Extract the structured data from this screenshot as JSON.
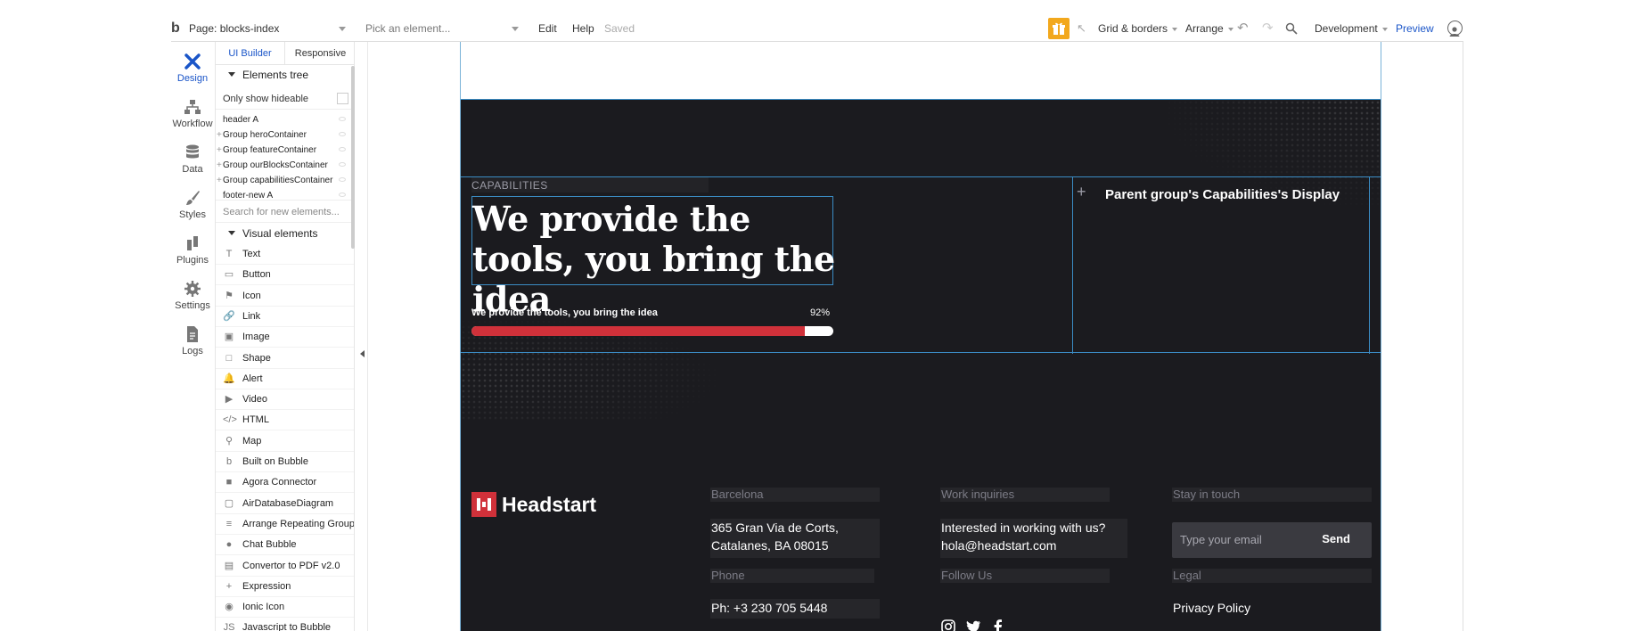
{
  "topbar": {
    "logo": "b",
    "page_select": "Page: blocks-index",
    "element_select": "Pick an element...",
    "edit": "Edit",
    "help": "Help",
    "saved": "Saved",
    "grid": "Grid & borders",
    "arrange": "Arrange",
    "environment": "Development",
    "preview": "Preview"
  },
  "sidebar": {
    "tabs": [
      {
        "label": "Design",
        "icon": "design-icon",
        "active": true
      },
      {
        "label": "Workflow",
        "icon": "workflow-icon"
      },
      {
        "label": "Data",
        "icon": "data-icon"
      },
      {
        "label": "Styles",
        "icon": "styles-icon"
      },
      {
        "label": "Plugins",
        "icon": "plugins-icon"
      },
      {
        "label": "Settings",
        "icon": "settings-icon"
      },
      {
        "label": "Logs",
        "icon": "logs-icon"
      }
    ]
  },
  "panel": {
    "tab_builder": "UI Builder",
    "tab_responsive": "Responsive",
    "tree_title": "Elements tree",
    "only_hideable": "Only show hideable",
    "tree": [
      "header A",
      "Group heroContainer",
      "Group featureContainer",
      "Group ourBlocksContainer",
      "Group capabilitiesContainer",
      "footer-new A"
    ],
    "search_placeholder": "Search for new elements...",
    "visual_title": "Visual elements",
    "elements": [
      {
        "label": "Text",
        "icon": "T"
      },
      {
        "label": "Button",
        "icon": "▭"
      },
      {
        "label": "Icon",
        "icon": "⚑"
      },
      {
        "label": "Link",
        "icon": "🔗"
      },
      {
        "label": "Image",
        "icon": "▣"
      },
      {
        "label": "Shape",
        "icon": "□"
      },
      {
        "label": "Alert",
        "icon": "🔔"
      },
      {
        "label": "Video",
        "icon": "▶"
      },
      {
        "label": "HTML",
        "icon": "</>"
      },
      {
        "label": "Map",
        "icon": "⚲"
      },
      {
        "label": "Built on Bubble",
        "icon": "b"
      },
      {
        "label": "Agora Connector",
        "icon": "■"
      },
      {
        "label": "AirDatabaseDiagram",
        "icon": "▢"
      },
      {
        "label": "Arrange Repeating Group",
        "icon": "≡"
      },
      {
        "label": "Chat Bubble",
        "icon": "●"
      },
      {
        "label": "Convertor to PDF v2.0",
        "icon": "▤"
      },
      {
        "label": "Expression",
        "icon": "+"
      },
      {
        "label": "Ionic Icon",
        "icon": "◉"
      },
      {
        "label": "Javascript to Bubble",
        "icon": "JS"
      }
    ]
  },
  "canvas": {
    "capabilities_label": "CAPABILITIES",
    "headline": "We provide the tools, you bring the idea",
    "progress_label": "We provide the tools, you bring the idea",
    "progress_percent_text": "92%",
    "progress_value": 0.92,
    "parent_group_text": "Parent group's Capabilities's Display",
    "footer": {
      "brand": "Headstart",
      "col1_title": "Barcelona",
      "col1_text": "365 Gran Via de Corts, Catalanes, BA 08015",
      "col2_title": "Work inquiries",
      "col2_text_1": "Interested in working with us?",
      "col2_text_2": "hola@headstart.com",
      "col3_title": "Stay in touch",
      "email_placeholder": "Type your email",
      "send": "Send",
      "phone_title": "Phone",
      "phone_text": "Ph: +3 230 705 5448",
      "follow_title": "Follow Us",
      "legal_title": "Legal",
      "privacy": "Privacy Policy"
    }
  },
  "colors": {
    "accent_red": "#d0313a",
    "dark_bg": "#1b1b1f",
    "link_blue": "#1a55c8",
    "gift_orange": "#f2a81d"
  }
}
